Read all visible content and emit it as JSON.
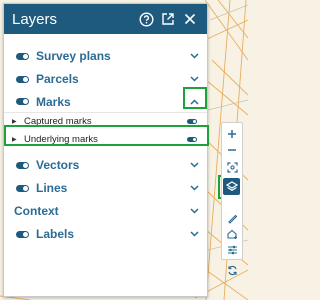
{
  "panel": {
    "title": "Layers",
    "header_icons": [
      "help-icon",
      "popout-icon",
      "close-icon"
    ]
  },
  "layers": [
    {
      "label": "Survey plans",
      "toggle": true,
      "state": "collapsed"
    },
    {
      "label": "Parcels",
      "toggle": true,
      "state": "collapsed"
    },
    {
      "label": "Marks",
      "toggle": true,
      "state": "expanded"
    },
    {
      "label": "Vectors",
      "toggle": true,
      "state": "collapsed"
    },
    {
      "label": "Lines",
      "toggle": true,
      "state": "collapsed"
    },
    {
      "label": "Context",
      "toggle": false,
      "state": "collapsed"
    },
    {
      "label": "Labels",
      "toggle": true,
      "state": "collapsed"
    }
  ],
  "marks_sublayers": [
    {
      "label": "Captured marks",
      "toggle": true
    },
    {
      "label": "Underlying marks",
      "toggle": true
    }
  ],
  "toolbar": {
    "buttons": [
      "zoom-in-icon",
      "zoom-out-icon",
      "zoom-extent-icon",
      "layers-icon",
      "measure-icon",
      "draw-shape-icon",
      "settings-sliders-icon",
      "sync-icon"
    ]
  },
  "colors": {
    "header": "#1e5a7d",
    "label": "#2b6b94",
    "highlight": "#1fa13a",
    "map_background": "#f7f2e3",
    "map_lines": "#e8a24a"
  }
}
